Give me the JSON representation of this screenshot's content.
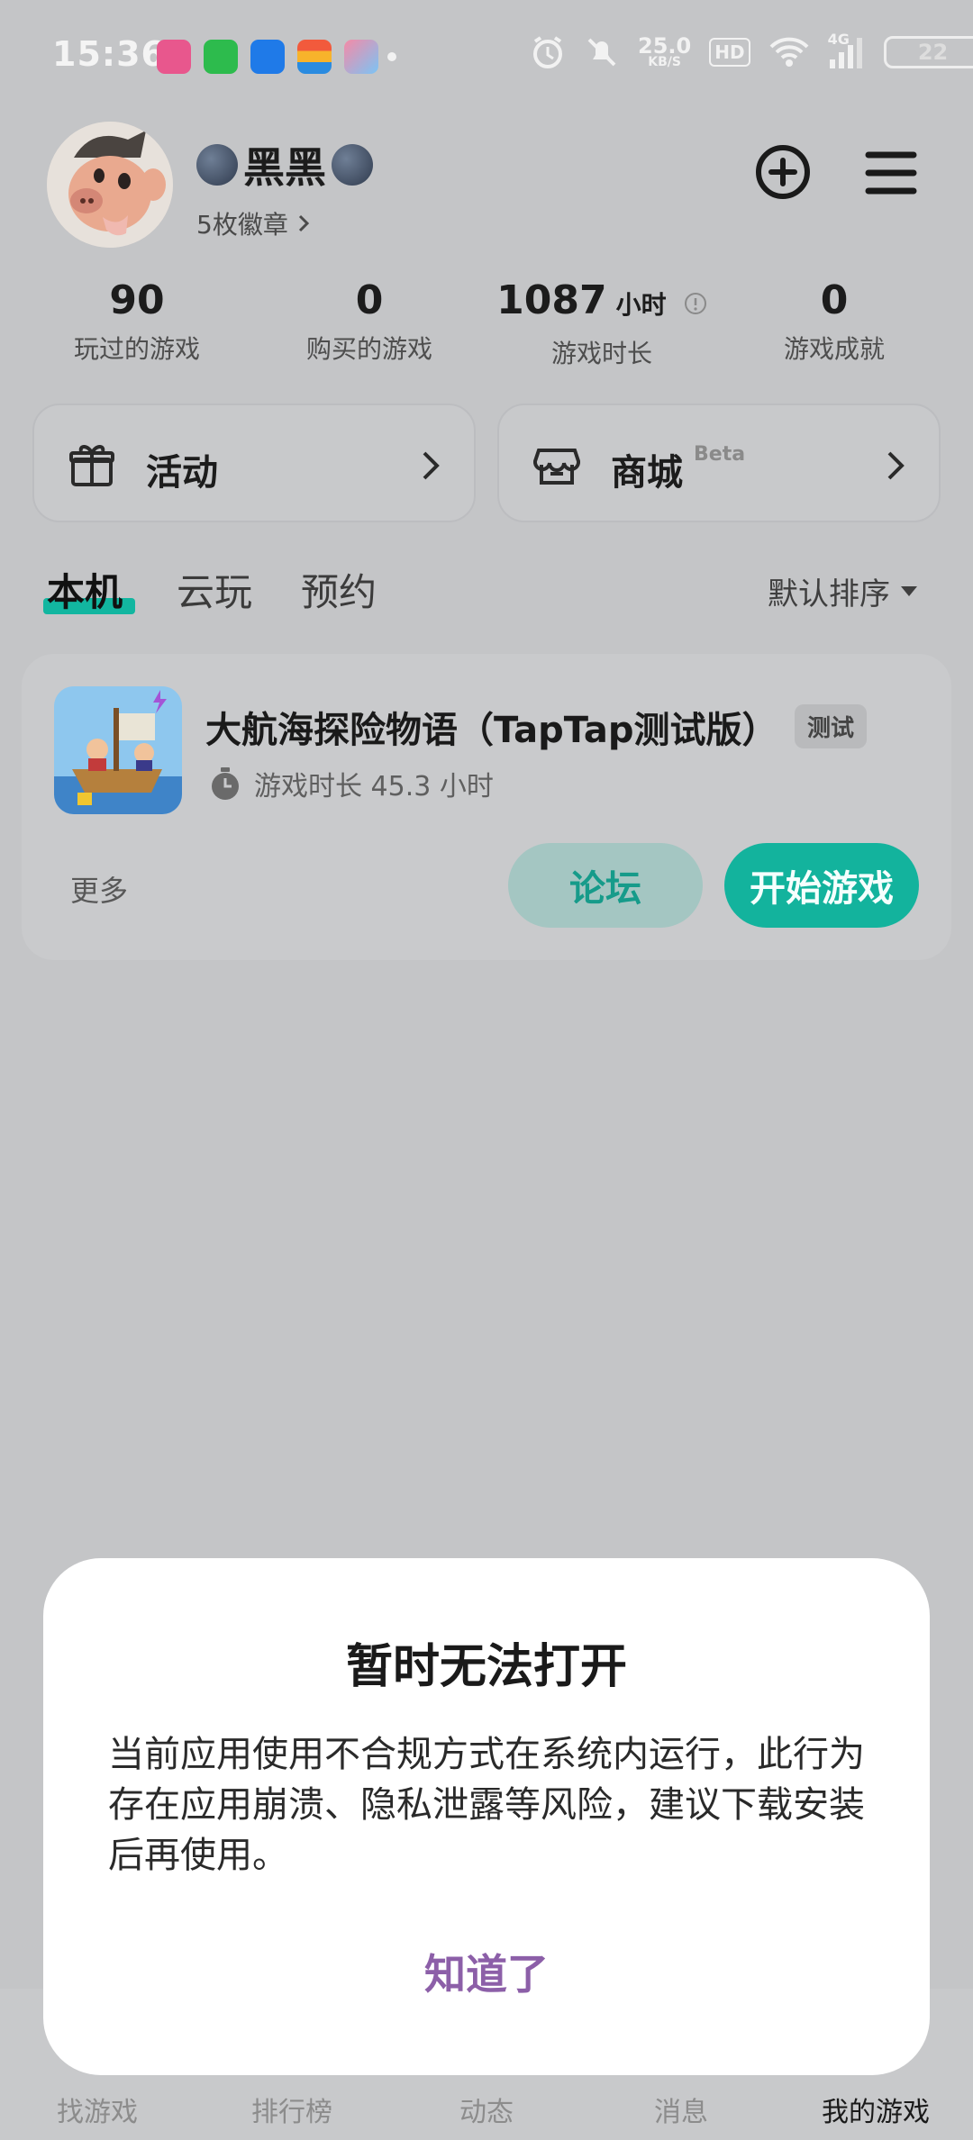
{
  "status_bar": {
    "time": "15:36",
    "net_speed": "25.0",
    "net_speed_unit": "KB/S",
    "hd_label": "HD",
    "network_type": "4G",
    "battery": "22"
  },
  "profile": {
    "username": "黑黑",
    "badges": "5枚徽章"
  },
  "stats": [
    {
      "value": "90",
      "unit": "",
      "label": "玩过的游戏"
    },
    {
      "value": "0",
      "unit": "",
      "label": "购买的游戏"
    },
    {
      "value": "1087",
      "unit": "小时",
      "label": "游戏时长"
    },
    {
      "value": "0",
      "unit": "",
      "label": "游戏成就"
    }
  ],
  "cards": {
    "activity": "活动",
    "store": "商城",
    "store_badge": "Beta"
  },
  "tabs": [
    "本机",
    "云玩",
    "预约"
  ],
  "sort_label": "默认排序",
  "game": {
    "title": "大航海探险物语（TapTap测试版）",
    "tag": "测试",
    "playtime": "游戏时长 45.3 小时",
    "more": "更多",
    "forum": "论坛",
    "start": "开始游戏"
  },
  "dialog": {
    "title": "暂时无法打开",
    "body": "当前应用使用不合规方式在系统内运行，此行为存在应用崩溃、隐私泄露等风险，建议下载安装后再使用。",
    "button": "知道了"
  },
  "bottom_nav": [
    "找游戏",
    "排行榜",
    "动态",
    "消息",
    "我的游戏"
  ],
  "colors": {
    "accent": "#13b39d",
    "dialog_button": "#8c5fa8",
    "overlay_bg": "#c4c5c7"
  }
}
